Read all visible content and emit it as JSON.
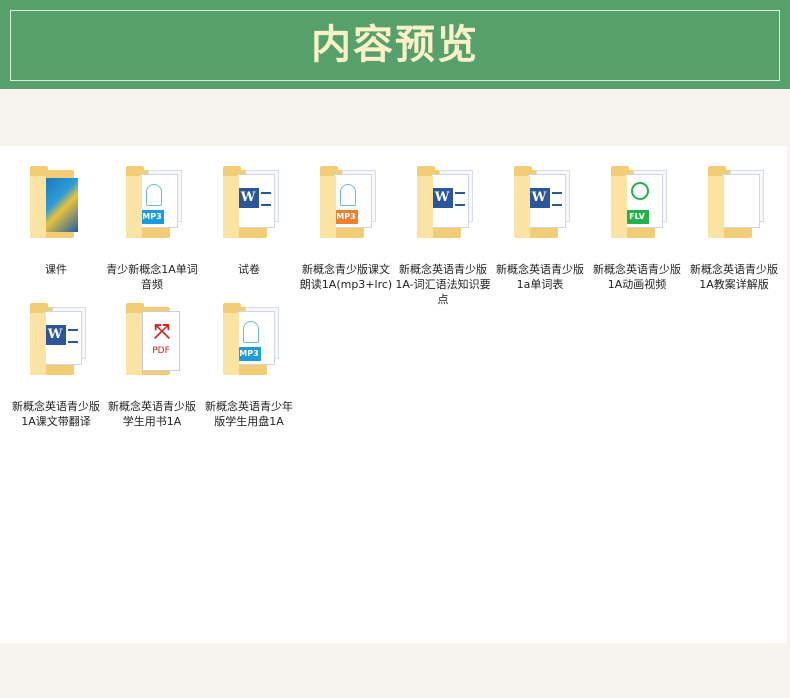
{
  "banner": {
    "title": "内容预览"
  },
  "items": [
    {
      "label": "课件",
      "type": "ppt"
    },
    {
      "label": "青少新概念1A单词音频",
      "type": "mp3-blue"
    },
    {
      "label": "试卷",
      "type": "word"
    },
    {
      "label": "新概念青少版课文朗读1A(mp3+lrc)",
      "type": "mp3-orange"
    },
    {
      "label": "新概念英语青少版1A-词汇语法知识要点",
      "type": "word"
    },
    {
      "label": "新概念英语青少版1a单词表",
      "type": "word"
    },
    {
      "label": "新概念英语青少版1A动画视频",
      "type": "flv"
    },
    {
      "label": "新概念英语青少版1A教案详解版",
      "type": "generic"
    },
    {
      "label": "新概念英语青少版1A课文带翻译",
      "type": "word"
    },
    {
      "label": "新概念英语青少版学生用书1A",
      "type": "pdf"
    },
    {
      "label": "新概念英语青少年版学生用盘1A",
      "type": "mp3-blue"
    }
  ],
  "colors": {
    "banner": "#55a06b",
    "title": "#fbf1c8",
    "mp3_blue": "#1e9be0",
    "mp3_orange": "#f08030",
    "flv": "#22b14c",
    "word": "#2b579a",
    "pdf": "#e02020"
  },
  "badges": {
    "mp3": "MP3",
    "flv": "FLV",
    "pdf": "PDF",
    "word": "W"
  }
}
